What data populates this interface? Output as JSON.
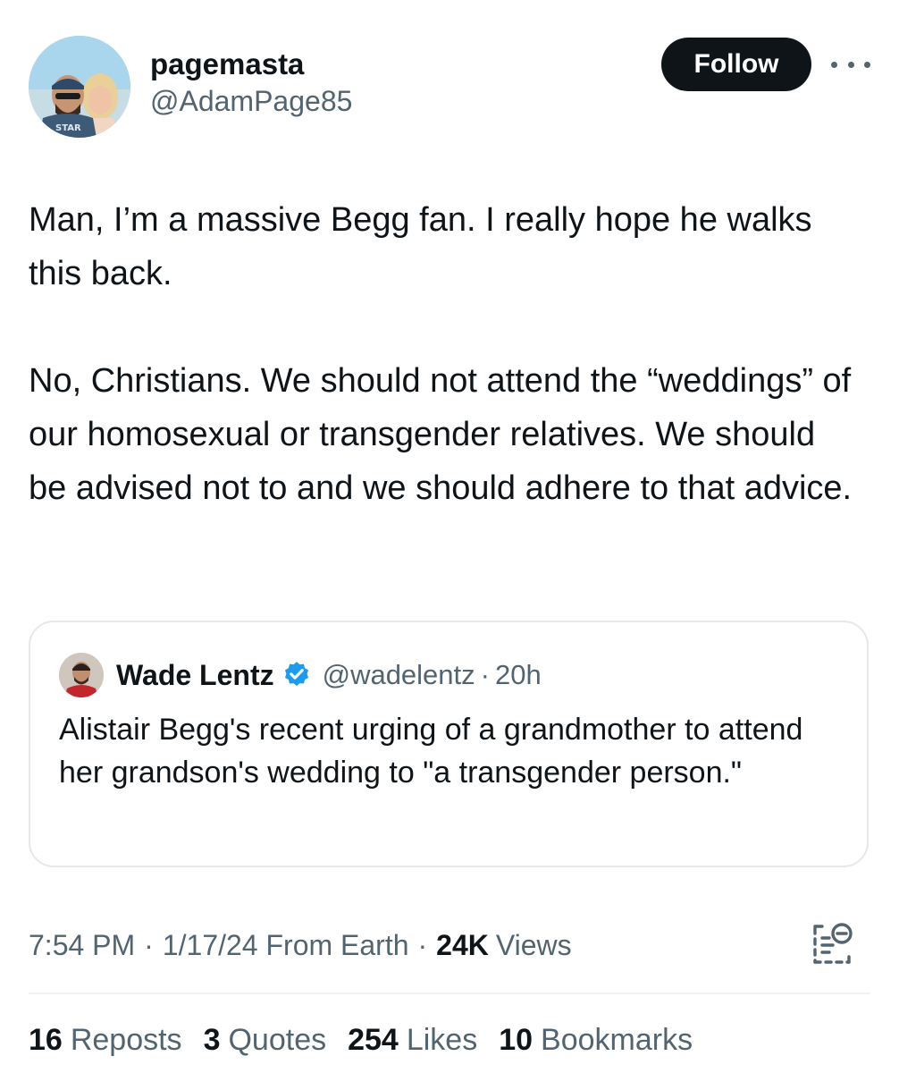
{
  "author": {
    "display_name": "pagemasta",
    "handle": "@AdamPage85",
    "avatar_icon": "profile-photo",
    "follow_label": "Follow"
  },
  "tweet": {
    "paragraphs": [
      "Man, I’m a massive Begg fan. I really hope he walks this back.",
      "No, Christians. We should not attend the “weddings” of our homosexual or transgender relatives. We should be advised not to and we should adhere to that advice."
    ]
  },
  "quoted": {
    "display_name": "Wade Lentz",
    "handle": "@wadelentz",
    "separator": "·",
    "time": "20h",
    "text": "Alistair Begg's recent urging of a grandmother to attend her grandson's wedding to \"a transgender person.\"",
    "verified_color": "#1d9bf0"
  },
  "meta": {
    "time": "7:54 PM",
    "separator": "·",
    "date": "1/17/24 From Earth",
    "views_count": "24K",
    "views_label": "Views"
  },
  "stats": {
    "reposts_count": "16",
    "reposts_label": "Reposts",
    "quotes_count": "3",
    "quotes_label": "Quotes",
    "likes_count": "254",
    "likes_label": "Likes",
    "bookmarks_count": "10",
    "bookmarks_label": "Bookmarks"
  },
  "colors": {
    "text_primary": "#0f1419",
    "text_secondary": "#536471",
    "button_bg": "#0f1419",
    "border": "#e6e9ec"
  }
}
